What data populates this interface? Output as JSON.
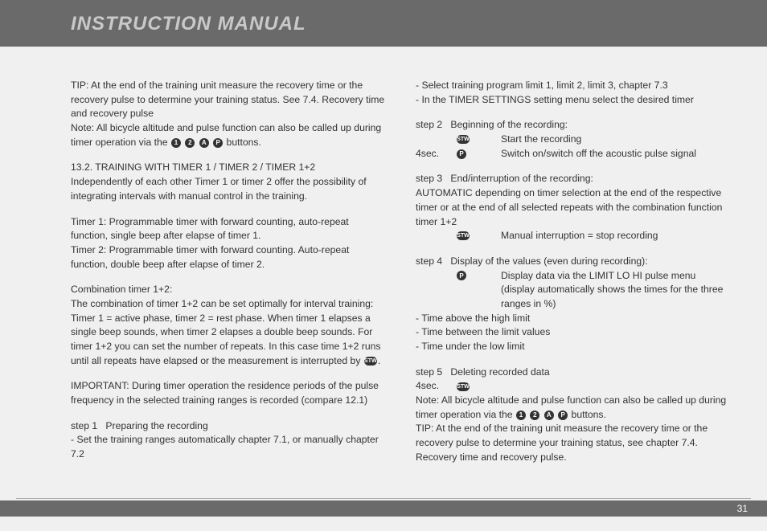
{
  "header": {
    "title": "INSTRUCTION MANUAL"
  },
  "footer": {
    "page": "31"
  },
  "icons": {
    "one": "1",
    "two": "2",
    "a": "A",
    "p": "P",
    "stw": "STW"
  },
  "left": {
    "tip_prefix": "TIP: At the end of the training unit measure the recovery time or the recovery pulse to determine your training status. See 7.4. Recovery time and recovery pulse",
    "note_prefix": "Note: All bicycle altitude and pulse function can also be called up during timer operation via the ",
    "note_suffix": " buttons.",
    "s132_title": "13.2. TRAINING WITH TIMER 1 / TIMER 2 / TIMER 1+2",
    "s132_body": "Independently of each other Timer 1 or timer 2 offer the possibility of integrating intervals with manual control in the training.",
    "timer1": "Timer 1: Programmable timer with forward counting, auto-repeat function, single beep after elapse of timer 1.",
    "timer2": "Timer 2: Programmable timer with forward counting. Auto-repeat function, double beep after elapse of timer 2.",
    "combo_title": "Combination timer 1+2:",
    "combo_body_pre": "The combination of timer 1+2 can be set optimally for interval training: Timer 1 = active phase, timer 2 = rest phase. When timer 1 elapses a single beep sounds, when timer 2 elapses a double beep sounds. For timer 1+2 you can set the number of repeats. In this case time 1+2 runs until all repeats have elapsed or the measurement is interrupted by ",
    "combo_body_post": ".",
    "important": "IMPORTANT: During timer operation the residence periods of the pulse frequency in the selected training ranges is recorded (compare 12.1)",
    "step1_label": "step 1",
    "step1_title": "Preparing the recording",
    "step1_line": "- Set the training ranges automatically chapter 7.1, or manually chapter 7.2"
  },
  "right": {
    "sel1": "- Select training program limit 1, limit 2, limit 3, chapter 7.3",
    "sel2": "- In the TIMER SETTINGS setting menu select the desired timer",
    "step2_label": "step 2",
    "step2_title": "Beginning of the recording:",
    "step2_r1_txt": "Start the recording",
    "step2_r2_lbl": "4sec.",
    "step2_r2_txt": "Switch on/switch off the acoustic pulse signal",
    "step3_label": "step 3",
    "step3_title": "End/interruption of the recording:",
    "step3_body": "AUTOMATIC depending on timer selection at the end of the respective timer or at the end of all selected repeats with the combination function timer 1+2",
    "step3_r1_txt": "Manual interruption = stop recording",
    "step4_label": "step 4",
    "step4_title": "Display of the values (even during recording):",
    "step4_r1_txt": "Display data via the LIMIT LO HI pulse menu (display automatically shows the times for the three ranges in %)",
    "step4_l1": "- Time above the high limit",
    "step4_l2": "- Time between the limit values",
    "step4_l3": "- Time under the low limit",
    "step5_label": "step 5",
    "step5_title": "Deleting recorded data",
    "step5_r1_lbl": "4sec.",
    "note2_prefix": "Note: All bicycle altitude and pulse function can also be called up during timer operation via the ",
    "note2_suffix": " buttons.",
    "tip2": "TIP: At the end of the training unit measure the recovery time or the recovery pulse to determine your training status, see chapter 7.4. Recovery time and recovery pulse."
  }
}
